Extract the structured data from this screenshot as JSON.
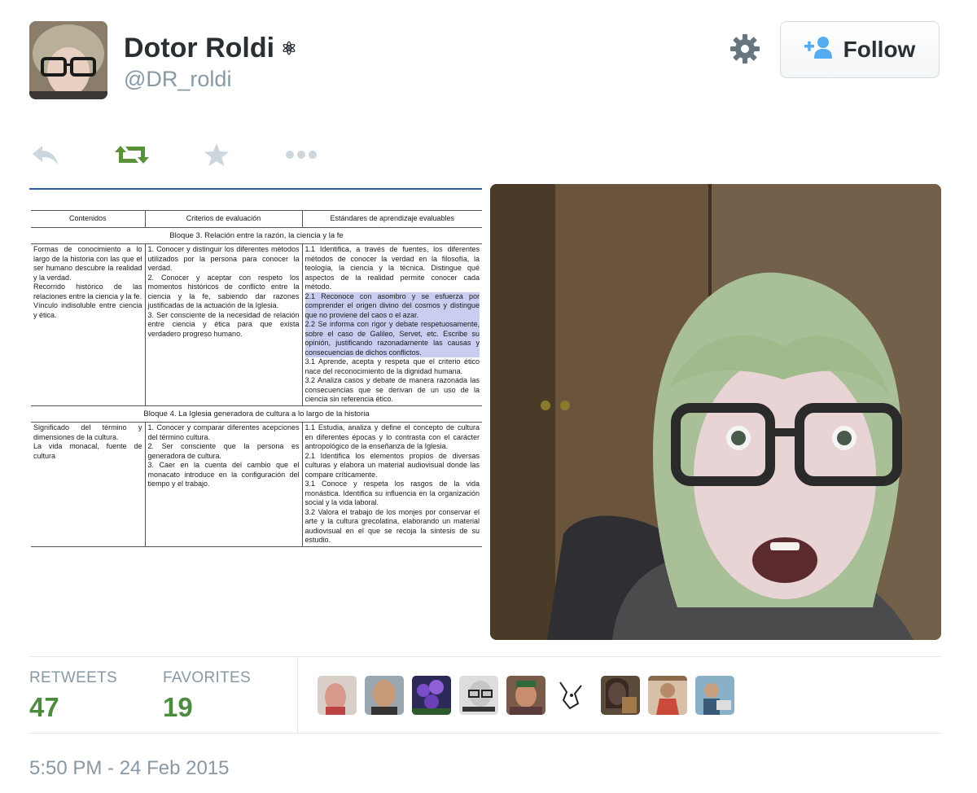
{
  "user": {
    "name": "Dotor Roldi",
    "name_symbol": "⚛",
    "handle": "@DR_roldi"
  },
  "follow_button": {
    "label": "Follow"
  },
  "stats": {
    "retweets_label": "RETWEETS",
    "retweets_count": "47",
    "favorites_label": "FAVORITES",
    "favorites_count": "19"
  },
  "timestamp": "5:50 PM - 24 Feb 2015",
  "colors": {
    "accent_green": "#4d8c3f",
    "muted": "#8899a6",
    "follow_icon_blue": "#55acee"
  },
  "document": {
    "headers": [
      "Contenidos",
      "Criterios de evaluación",
      "Estándares de aprendizaje  evaluables"
    ],
    "block3_title": "Bloque 3.   Relación entre la razón, la ciencia y  la fe",
    "block3_contents": [
      "Formas de conocimiento a lo largo de la historia con las que el ser humano descubre la realidad y la verdad.",
      "Recorrido histórico de las relaciones entre la ciencia y la fe.",
      "Vínculo indisoluble entre ciencia y ética."
    ],
    "block3_criteria": [
      "1.  Conocer y distinguir los diferentes métodos utilizados por la persona para conocer la verdad.",
      "2.  Conocer y aceptar con respeto los momentos históricos de conflicto entre la ciencia y la fe, sabiendo dar razones justificadas de la actuación de la Iglesia.",
      "3.  Ser consciente de la necesidad de relación entre ciencia y ética para que exista verdadero  progreso humano."
    ],
    "block3_standards": [
      "1.1  Identifica, a través de fuentes, los diferentes métodos de conocer la verdad en la filosofía, la teología, la ciencia y la técnica. Distingue qué aspectos de la realidad permite conocer cada método.",
      "2.1  Reconoce con asombro y se esfuerza por comprender el origen divino del cosmos y distingue  que no proviene del caos o el azar.",
      "2.2  Se informa con rigor y debate respetuosamente, sobre el caso de Galileo, Servet, etc. Escribe su opinión, justificando razonadamente las causas y consecuencias de dichos conflictos.",
      "3.1  Aprende, acepta y respeta que el criterio ético nace del reconocimiento de la dignidad humana.",
      "3.2  Analiza casos y debate de manera razonada las consecuencias que se derivan de un uso de la ciencia sin referencia ético."
    ],
    "block4_title": "Bloque 4.   La Iglesia generadora de cultura a lo largo de la historia",
    "block4_contents": [
      "Significado del término y dimensiones de la cultura.",
      "La vida monacal, fuente de cultura"
    ],
    "block4_criteria": [
      "1.  Conocer y comparar diferentes acepciones del término cultura.",
      "2.  Ser consciente que la persona es generadora de cultura.",
      "3.  Caer en la cuenta del cambio que el monacato introduce en la configuración del tiempo y el trabajo."
    ],
    "block4_standards": [
      "1.1  Estudia, analiza y define el concepto de cultura en diferentes épocas y lo contrasta con el carácter antropológico de la enseñanza de la Iglesia.",
      "2.1  Identifica los elementos propios de diversas culturas y elabora un material audiovisual donde las compare críticamente.",
      "3.1  Conoce y respeta los rasgos de la vida monástica. Identifica su influencia en la organización social y la vida laboral.",
      "3.2  Valora el trabajo de los monjes por conservar el arte y la cultura grecolatina, elaborando un material audiovisual en el que se recoja la síntesis de su estudio."
    ]
  }
}
